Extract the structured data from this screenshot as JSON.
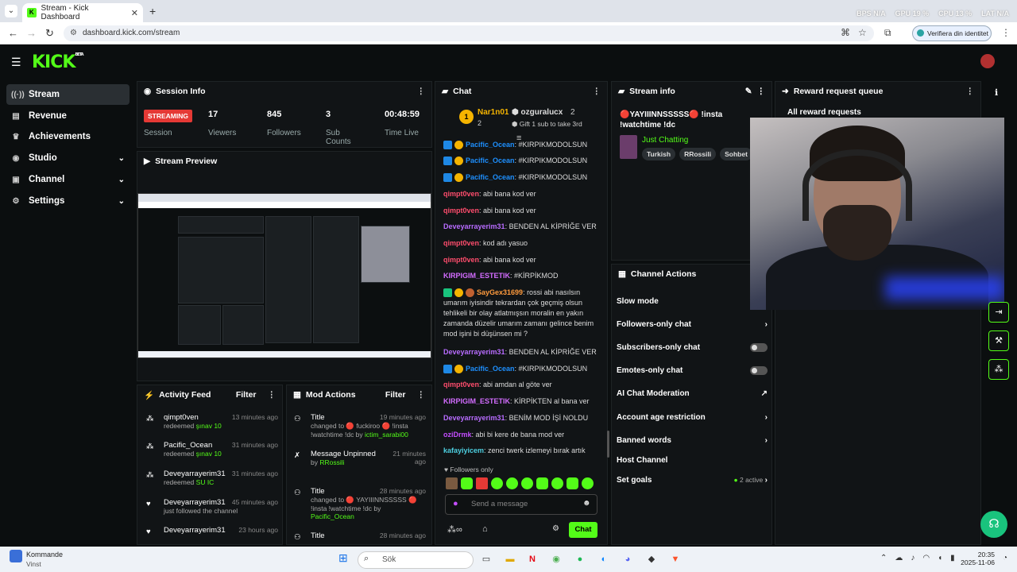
{
  "browser": {
    "tab_title": "Stream - Kick Dashboard",
    "url": "dashboard.kick.com/stream",
    "identity_button": "Verifiera din identitet",
    "perf": [
      "BPS N/A",
      "GPU 19 %",
      "CPU 13 %",
      "LAT N/A"
    ]
  },
  "brand": {
    "logo": "KICK",
    "beta": "BETA"
  },
  "sidebar": [
    {
      "label": "Stream",
      "icon": "stream-icon"
    },
    {
      "label": "Revenue",
      "icon": "revenue-icon"
    },
    {
      "label": "Achievements",
      "icon": "trophy-icon"
    },
    {
      "label": "Studio",
      "icon": "studio-icon"
    },
    {
      "label": "Channel",
      "icon": "channel-icon"
    },
    {
      "label": "Settings",
      "icon": "gear-icon"
    }
  ],
  "session": {
    "title": "Session Info",
    "status": "STREAMING",
    "status_label": "Session",
    "viewers": "17",
    "viewers_label": "Viewers",
    "followers": "845",
    "followers_label": "Followers",
    "subs": "3",
    "subs_label": "Sub Counts",
    "uptime": "00:48:59",
    "uptime_label": "Time Live"
  },
  "preview": {
    "title": "Stream Preview"
  },
  "chat": {
    "title": "Chat",
    "leader1": {
      "name": "Nar1n01",
      "count": "2"
    },
    "leader2": {
      "name": "ozguralucx",
      "count": "2",
      "note": "Gift 1 sub to take 3rd"
    },
    "messages": [
      {
        "user": "Pacific_Ocean",
        "text": ": #KIRPIKMODOLSUN"
      },
      {
        "user": "Pacific_Ocean",
        "text": ": #KIRPIKMODOLSUN"
      },
      {
        "user": "Pacific_Ocean",
        "text": ": #KIRPIKMODOLSUN"
      },
      {
        "user": "qimpt0ven",
        "text": ": abi bana kod ver"
      },
      {
        "user": "qimpt0ven",
        "text": ": abi bana kod ver"
      },
      {
        "user": "Deveyarrayerim31",
        "text": ": BENDEN AL KİPRİĞE VER"
      },
      {
        "user": "qimpt0ven",
        "text": ": kod adı yasuo"
      },
      {
        "user": "qimpt0ven",
        "text": ": abi bana kod ver"
      },
      {
        "user": "KIRPIGIM_ESTETIK",
        "text": ": #KİRPİKMOD"
      },
      {
        "user": "SayGex31699",
        "text": ": rossi abi nasılsın umarım iyisindir tekrardan çok geçmiş olsun tehlikeli bir olay atlatmışsın moralin en yakın zamanda düzelir umarım zamanı gelince benim mod işini bi düşünsen mi ?"
      },
      {
        "user": "Deveyarrayerim31",
        "text": ": BENDEN AL KİPRİĞE VER"
      },
      {
        "user": "Pacific_Ocean",
        "text": ": #KIRPIKMODOLSUN"
      },
      {
        "user": "qimpt0ven",
        "text": ": abi amdan al göte ver"
      },
      {
        "user": "KIRPIGIM_ESTETIK",
        "text": ": KİRPİKTEN al bana ver"
      },
      {
        "user": "Deveyarrayerim31",
        "text": ": BENİM MOD İŞİ NOLDU"
      },
      {
        "user": "oziDrmk",
        "text": ": abi bi kere de bana mod ver"
      },
      {
        "user": "kafayiyicem",
        "text": ": zenci twerk izlemeyi bırak artık"
      }
    ],
    "followers_only": "Followers only",
    "input_placeholder": "Send a message",
    "send": "Chat"
  },
  "activity": {
    "title": "Activity Feed",
    "filter": "Filter",
    "items": [
      {
        "user": "qimpt0ven",
        "time": "13 minutes ago",
        "action": "redeemed",
        "reward": "şınav 10"
      },
      {
        "user": "Pacific_Ocean",
        "time": "31 minutes ago",
        "action": "redeemed",
        "reward": "şınav 10"
      },
      {
        "user": "Deveyarrayerim31",
        "time": "31 minutes ago",
        "action": "redeemed",
        "reward": "SU IC"
      },
      {
        "user": "Deveyarrayerim31",
        "time": "45 minutes ago",
        "action": "just followed the channel",
        "reward": ""
      },
      {
        "user": "Deveyarrayerim31",
        "time": "23 hours ago",
        "action": "",
        "reward": ""
      }
    ]
  },
  "mod": {
    "title": "Mod Actions",
    "filter": "Filter",
    "items": [
      {
        "title": "Title",
        "time": "19 minutes ago",
        "detail": "changed to 🔴 fuckiroo 🔴 !insta !watchtime !dc by",
        "by": "ictim_sarabi00"
      },
      {
        "title": "Message Unpinned",
        "time": "21 minutes ago",
        "detail": "by",
        "by": "RRossili"
      },
      {
        "title": "Title",
        "time": "28 minutes ago",
        "detail": "changed to 🔴 YAYIIINNSSSSS 🔴 !insta !watchtime !dc by",
        "by": "Pacific_Ocean"
      },
      {
        "title": "Title",
        "time": "28 minutes ago",
        "detail": "",
        "by": ""
      }
    ]
  },
  "streaminfo": {
    "title": "Stream info",
    "stream_title": "🔴YAYIIINNSSSSS🔴 !insta !watchtime !dc",
    "category": "Just Chatting",
    "tags": [
      "Turkish",
      "RRossili",
      "Sohbet"
    ]
  },
  "actions": {
    "title": "Channel Actions",
    "items": [
      "Slow mode",
      "Followers-only chat",
      "Subscribers-only chat",
      "Emotes-only chat",
      "AI Chat Moderation",
      "Account age restriction",
      "Banned words",
      "Host Channel",
      "Set goals"
    ],
    "goals_active": "2 active"
  },
  "reward": {
    "title": "Reward request queue",
    "all": "All reward requests"
  },
  "taskbar": {
    "weather_title": "Kommande",
    "weather_sub": "Vinst",
    "search": "Sök",
    "time": "20:35",
    "date": "2025-11-06"
  }
}
